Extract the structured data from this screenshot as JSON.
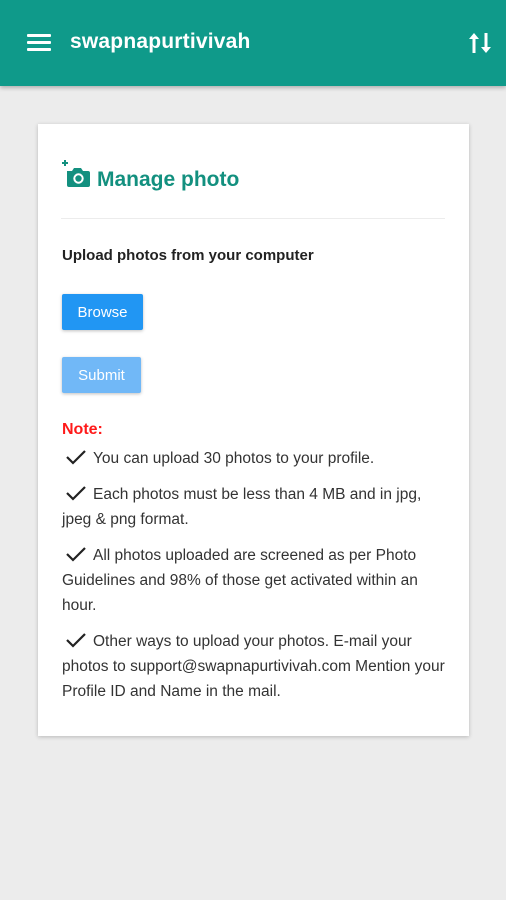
{
  "appbar": {
    "title": "swapnapurtivivah",
    "menu_icon": "hamburger-menu-icon",
    "action_icon": "sort-arrows-icon",
    "color": "#0f9a8a"
  },
  "card": {
    "title": "Manage photo",
    "title_icon": "add-photo-camera-icon",
    "upload_label": "Upload photos from your computer",
    "browse_label": "Browse",
    "submit_label": "Submit",
    "note_label": "Note:",
    "notes": [
      "You can upload 30 photos to your profile.",
      "Each photos must be less than 4 MB and in jpg, jpeg & png format.",
      "All photos uploaded are screened as per Photo Guidelines and 98% of those get activated within an hour.",
      "Other ways to upload your photos. E-mail your photos to support@swapnapurtivivah.com Mention your Profile ID and Name in the mail."
    ]
  },
  "colors": {
    "accent": "#13907f",
    "browse_button": "#2196f3",
    "submit_button": "#71b8f7",
    "note": "#ff1a1a"
  }
}
